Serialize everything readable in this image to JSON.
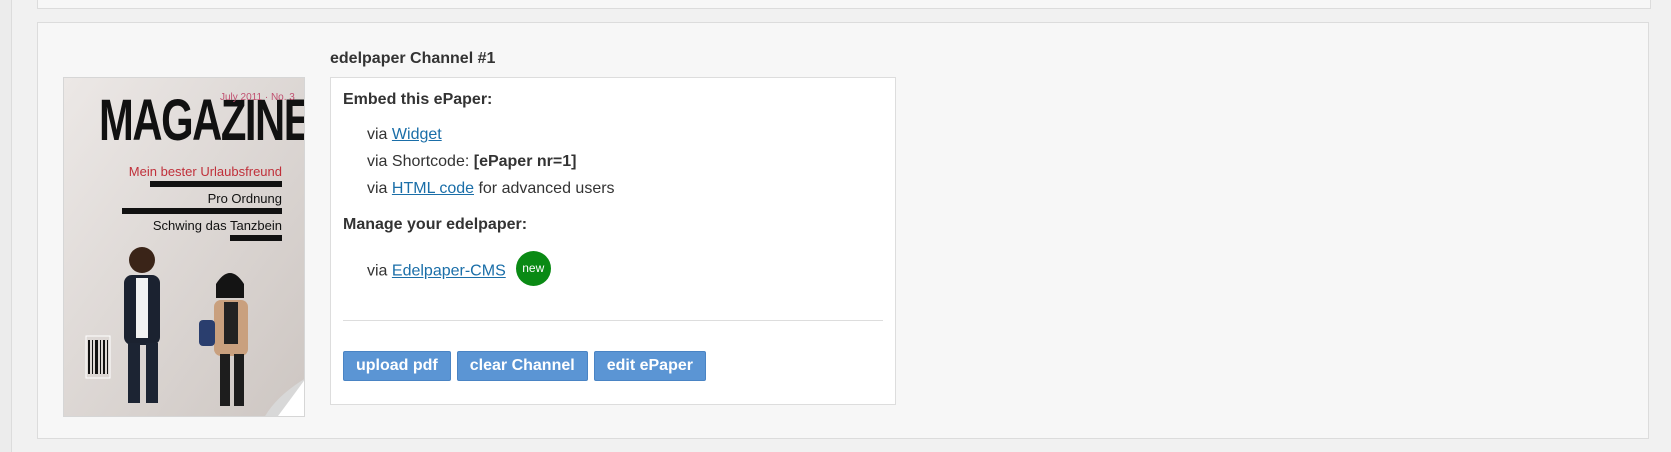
{
  "channel": {
    "title": "edelpaper Channel #1"
  },
  "cover": {
    "title": "MAGAZINE",
    "date": "July 2011 · No. 3",
    "headline_1": "Mein bester Urlaubsfreund",
    "headline_2": "Pro Ordnung",
    "headline_3": "Schwing das Tanzbein"
  },
  "embed": {
    "heading": "Embed this ePaper:",
    "widget_prefix": "via ",
    "widget_link": "Widget",
    "shortcode_prefix": "via Shortcode: ",
    "shortcode_value": "[ePaper nr=1]",
    "html_prefix": "via ",
    "html_link": "HTML code",
    "html_suffix": " for advanced users"
  },
  "manage": {
    "heading": "Manage your edelpaper:",
    "cms_prefix": "via ",
    "cms_link": "Edelpaper-CMS",
    "badge": "new"
  },
  "buttons": {
    "upload": "upload pdf",
    "clear": "clear Channel",
    "edit": "edit ePaper"
  },
  "colors": {
    "button_bg": "#5b95d4",
    "link": "#1a6ea8",
    "badge_bg": "#0a8a14"
  }
}
